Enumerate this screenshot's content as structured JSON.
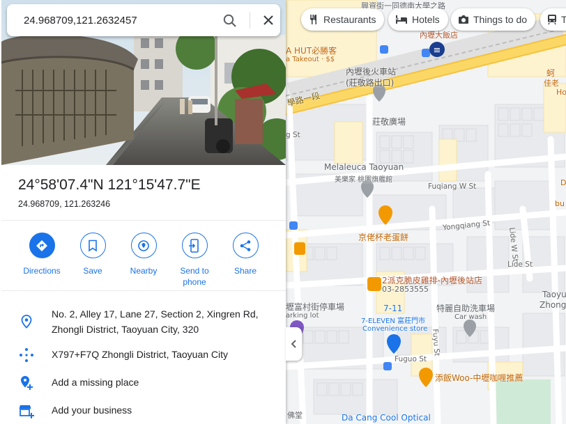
{
  "search": {
    "value": "24.968709,121.2632457"
  },
  "place": {
    "dms": "24°58'07.4\"N 121°15'47.7\"E",
    "decimal": "24.968709, 121.263246"
  },
  "actions": [
    {
      "label": "Directions",
      "icon": "directions-icon"
    },
    {
      "label": "Save",
      "icon": "bookmark-icon"
    },
    {
      "label": "Nearby",
      "icon": "nearby-icon"
    },
    {
      "label": "Send to phone",
      "icon": "send-to-phone-icon"
    },
    {
      "label": "Share",
      "icon": "share-icon"
    }
  ],
  "info": {
    "address": "No. 2, Alley 17, Lane 27, Section 2, Xingren Rd, Zhongli District, Taoyuan City, 320",
    "plus_code": "X797+F7Q Zhongli District, Taoyuan City",
    "add_place": "Add a missing place",
    "add_business": "Add your business"
  },
  "chips": [
    {
      "label": "Restaurants",
      "icon": "restaurant-icon"
    },
    {
      "label": "Hotels",
      "icon": "hotel-icon"
    },
    {
      "label": "Things to do",
      "icon": "camera-icon"
    },
    {
      "label": "T",
      "icon": "transit-icon"
    }
  ],
  "map_labels": {
    "top_street": "興資街一同德南大學之路",
    "pizza_hut": "A HUT必勝客",
    "pizza_sub": "a Takeout · $$",
    "station": "內壢後火車站",
    "station_sub": "(莊敬路出口)",
    "road1": "學路一段",
    "plaza": "莊敬廣場",
    "melaleuca": "Melaleuca Taoyuan",
    "melaleuca_cn": "美樂家 桃園旗艦館",
    "fuqiang": "Fuqiang W St",
    "yongqiang": "Yongqiang St",
    "pastry": "京佬杯老蛋餅",
    "lide": "Lide St",
    "lide_w": "Lide W St",
    "chicken": "2派克脆皮雞排-內壢後站店",
    "chicken_phone": "03-2853555",
    "parking": "壢富村街停車場",
    "parking_en": "arking lot",
    "seven": "7-11",
    "seven_full": "7-ELEVEN 富莊門市",
    "convenience": "Convenience store",
    "carwash_cn": "特麗自助洗車場",
    "carwash": "Car wash",
    "fuyu": "Fuyu St",
    "fuguo": "Fuguo St",
    "woo": "添飯Woo-中壢咖喱推薦",
    "dacang": "Da Cang Cool Optical",
    "taoyuan_right": "Taoyu",
    "zhongli_right": "Zhong",
    "right_snip1": "蚵",
    "right_snip2": "佳老",
    "right_snip3": "Ho",
    "hotel_snip": "內壢大飯店",
    "bottom_left": "佛堂",
    "left_st": "g St",
    "d_snip": "D",
    "bu_snip": "bu"
  }
}
